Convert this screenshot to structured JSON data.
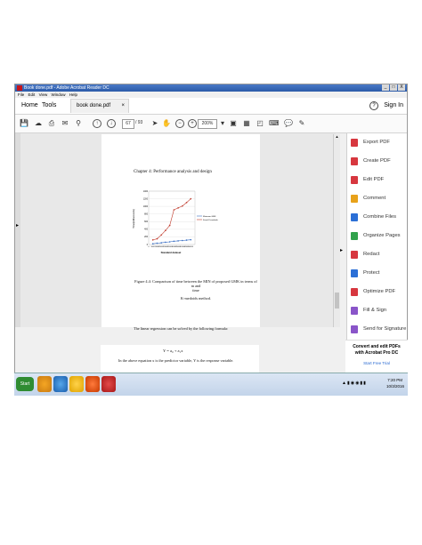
{
  "window": {
    "title": "Book done.pdf - Adobe Acrobat Reader DC",
    "controls": [
      "_",
      "□",
      "X"
    ]
  },
  "menu": [
    "File",
    "Edit",
    "View",
    "Window",
    "Help"
  ],
  "tabs": {
    "home": "Home",
    "tools": "Tools",
    "document": "book done.pdf",
    "close": "×",
    "help": "?",
    "sign_in": "Sign In"
  },
  "toolbar": {
    "page_current": "67",
    "page_total": "/ 93",
    "zoom": "200%"
  },
  "page": {
    "heading": "Chapter 4: Performance analysis and design",
    "figure_caption_line1": "Figure 4.4: Comparison of time between the MIN          of proposed GMK in terms of m and",
    "figure_caption_line2": "time",
    "figure_caption_line3": "K-medoids method.",
    "paragraph1": "The linear regression can be solved by the following formula:",
    "formula": "Y = a₀ + a₁x",
    "paragraph2": "In the above equation x is the predictor variable, Y is the response variable."
  },
  "right_panel": {
    "items": [
      {
        "label": "Export PDF",
        "color": "#d7373f"
      },
      {
        "label": "Create PDF",
        "color": "#d7373f"
      },
      {
        "label": "Edit PDF",
        "color": "#d7373f"
      },
      {
        "label": "Comment",
        "color": "#e8a21a"
      },
      {
        "label": "Combine Files",
        "color": "#2b6fd6"
      },
      {
        "label": "Organize Pages",
        "color": "#31a24c"
      },
      {
        "label": "Redact",
        "color": "#d7373f"
      },
      {
        "label": "Protect",
        "color": "#2b6fd6"
      },
      {
        "label": "Optimize PDF",
        "color": "#d7373f"
      },
      {
        "label": "Fill & Sign",
        "color": "#8a55c9"
      },
      {
        "label": "Send for Signature",
        "color": "#8a55c9"
      }
    ],
    "promo_line1": "Convert and edit PDFs",
    "promo_line2": "with Acrobat Pro DC",
    "promo_link": "Start Free Trial"
  },
  "taskbar": {
    "start": "Start",
    "time": "7:20 PM",
    "date": "10/3/2016"
  },
  "chart_data": {
    "type": "line",
    "title": "",
    "xlabel": "Standard dataset",
    "ylabel": "Time(milliseconds)",
    "x": [
      5000,
      10000,
      15000,
      20000,
      25000,
      30000,
      35000,
      40000,
      45000,
      50000
    ],
    "x_tick_labels": [
      "0",
      "5000",
      "10000",
      "15000",
      "20000",
      "25000",
      "30000",
      "35000",
      "40000",
      "45000",
      "50000"
    ],
    "xlim": [
      0,
      55000
    ],
    "ylim": [
      0,
      1400
    ],
    "y_ticks": [
      0,
      200,
      400,
      600,
      800,
      1000,
      1200,
      1400
    ],
    "legend": "right",
    "grid": true,
    "series": [
      {
        "name": "Minimum GMK",
        "color": "#3a6fc4",
        "values": [
          20,
          35,
          45,
          60,
          70,
          85,
          95,
          105,
          115,
          125
        ]
      },
      {
        "name": "Kmed K-medoids",
        "color": "#c0392b",
        "values": [
          120,
          150,
          250,
          370,
          500,
          910,
          960,
          1010,
          1100,
          1200
        ]
      }
    ]
  }
}
